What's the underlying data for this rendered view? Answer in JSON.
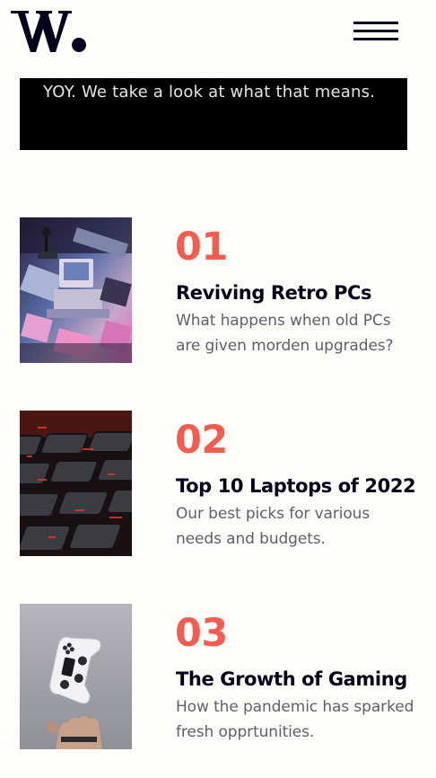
{
  "header": {
    "logo_alt": "W.",
    "menu_label": "Menu"
  },
  "banner": {
    "text": "YOY. We take a look at what that means."
  },
  "articles": [
    {
      "number": "01",
      "title": "Reviving Retro PCs",
      "description": "What happens when old PCs are given morden upgrades?",
      "image": "retro-pc-image"
    },
    {
      "number": "02",
      "title": "Top 10 Laptops of 2022",
      "description": "Our best picks for various needs and budgets.",
      "image": "laptop-keyboard-image"
    },
    {
      "number": "03",
      "title": "The Growth of Gaming",
      "description": "How the pandemic has sparked fresh opprtunities.",
      "image": "game-controller-image"
    }
  ],
  "colors": {
    "accent": "#f15e50",
    "dark": "#00001a",
    "text_muted": "#5d5f6d",
    "background": "#fffdfa"
  }
}
